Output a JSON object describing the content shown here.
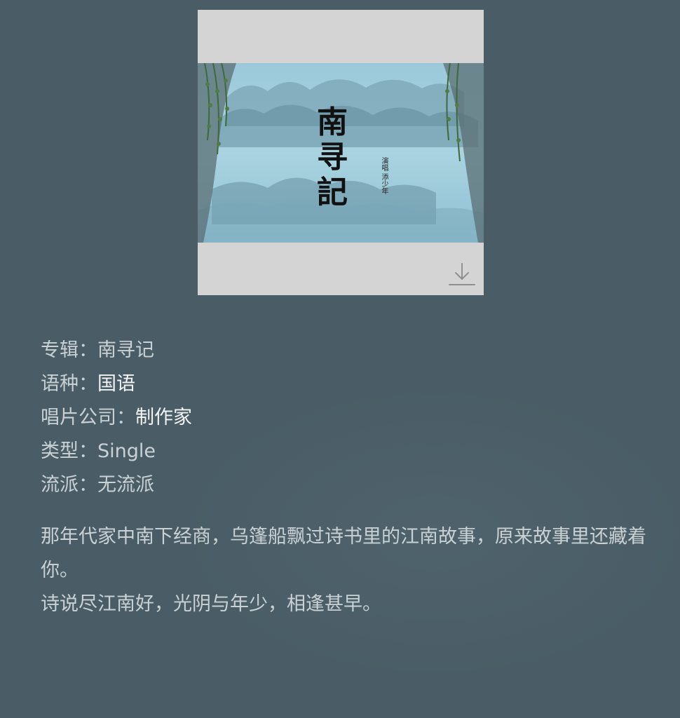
{
  "cover": {
    "title_calligraphy": "南寻記",
    "credit_text": "演唱 添少年",
    "download_icon": "download-icon"
  },
  "info": {
    "album_label": "专辑：",
    "album_value": "南寻记",
    "language_label": "语种：",
    "language_value": "国语",
    "label_label": "唱片公司：",
    "label_value": "制作家",
    "type_label": "类型：",
    "type_value": "Single",
    "genre_label": "流派：",
    "genre_value": "无流派"
  },
  "description": {
    "line1": "那年代家中南下经商，乌篷船飘过诗书里的江南故事，原来故事里还藏着你。",
    "line2": "诗说尽江南好，光阴与年少，相逢甚早。"
  },
  "colors": {
    "background": "#4a5d66",
    "cover_frame": "#d4d4d4",
    "text_muted": "#c9d1d5",
    "text_bright": "#f2f4f5"
  }
}
